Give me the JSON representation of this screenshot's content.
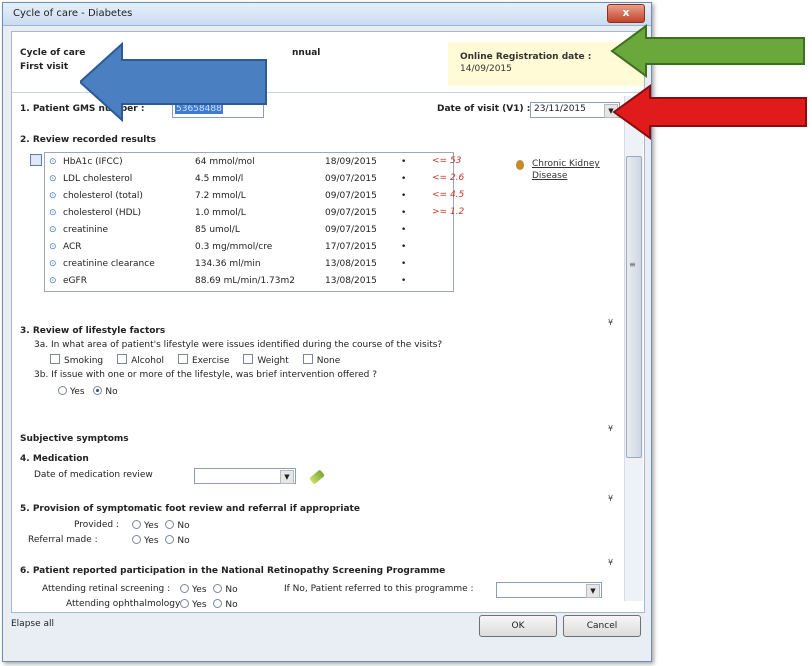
{
  "window": {
    "title": "Cycle of care - Diabetes",
    "close_label": "x"
  },
  "header": {
    "cycle_label": "Cycle of care",
    "visit_label": "First visit",
    "annual_label": "nnual",
    "registration_label": "Online Registration date :",
    "registration_value": "14/09/2015"
  },
  "section1": {
    "title": "1. Patient GMS number :",
    "gms_value": "53658488",
    "date_label": "Date of visit (V1) :",
    "date_value": "23/11/2015"
  },
  "section2": {
    "title": "2. Review recorded results",
    "rows": [
      {
        "name": "HbA1c (IFCC)",
        "value": "64 mmol/mol",
        "date": "18/09/2015",
        "range": "<= 53"
      },
      {
        "name": "LDL cholesterol",
        "value": "4.5 mmol/l",
        "date": "09/07/2015",
        "range": "<= 2.6"
      },
      {
        "name": "cholesterol (total)",
        "value": "7.2 mmol/L",
        "date": "09/07/2015",
        "range": "<= 4.5"
      },
      {
        "name": "cholesterol (HDL)",
        "value": "1.0 mmol/L",
        "date": "09/07/2015",
        "range": ">= 1.2"
      },
      {
        "name": "creatinine",
        "value": "85 umol/L",
        "date": "09/07/2015",
        "range": ""
      },
      {
        "name": "ACR",
        "value": "0.3 mg/mmol/cre",
        "date": "17/07/2015",
        "range": ""
      },
      {
        "name": "creatinine clearance",
        "value": "134.36 ml/min",
        "date": "13/08/2015",
        "range": ""
      },
      {
        "name": "eGFR",
        "value": "88.69 mL/min/1.73m2",
        "date": "13/08/2015",
        "range": ""
      }
    ],
    "ckd_line1": "Chronic Kidney",
    "ckd_line2": "Disease"
  },
  "section3": {
    "title": "3. Review of lifestyle factors",
    "q3a": "3a. In what area of patient's lifestyle were issues identified during the course of the visits?",
    "options": [
      "Smoking",
      "Alcohol",
      "Exercise",
      "Weight",
      "None"
    ],
    "q3b": "3b. If issue with one or more of the lifestyle, was brief intervention offered ?",
    "yes": "Yes",
    "no": "No"
  },
  "subjective": {
    "title": "Subjective symptoms"
  },
  "section4": {
    "title": "4. Medication",
    "label": "Date of medication review"
  },
  "section5": {
    "title": "5. Provision of symptomatic foot review and referral if appropriate",
    "provided": "Provided :",
    "referral": "Referral made :",
    "yes": "Yes",
    "no": "No"
  },
  "section6": {
    "title": "6. Patient reported participation in the National Retinopathy Screening Programme",
    "attending_retinal": "Attending retinal screening :",
    "referred": "If No, Patient referred to this programme :",
    "attending_ophth": "Attending  ophthalmology",
    "yes": "Yes",
    "no": "No"
  },
  "footer": {
    "elapse": "Elapse all",
    "ok": "OK",
    "cancel": "Cancel"
  },
  "colors": {
    "arrow_blue": "#4a7fc1",
    "arrow_green": "#6aa83c",
    "arrow_red": "#e11b1b"
  }
}
